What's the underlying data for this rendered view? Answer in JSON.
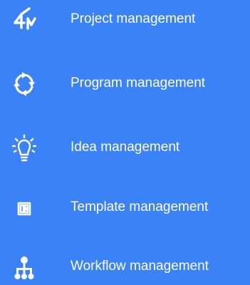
{
  "menu": {
    "items": [
      {
        "label": "Project management",
        "icon": "project-icon"
      },
      {
        "label": "Program management",
        "icon": "cycle-arrows-icon"
      },
      {
        "label": "Idea management",
        "icon": "lightbulb-icon"
      },
      {
        "label": "Template management",
        "icon": "template-icon"
      },
      {
        "label": "Workflow management",
        "icon": "hierarchy-icon"
      }
    ]
  },
  "colors": {
    "background": "#3b82f6",
    "foreground": "#ffffff"
  }
}
